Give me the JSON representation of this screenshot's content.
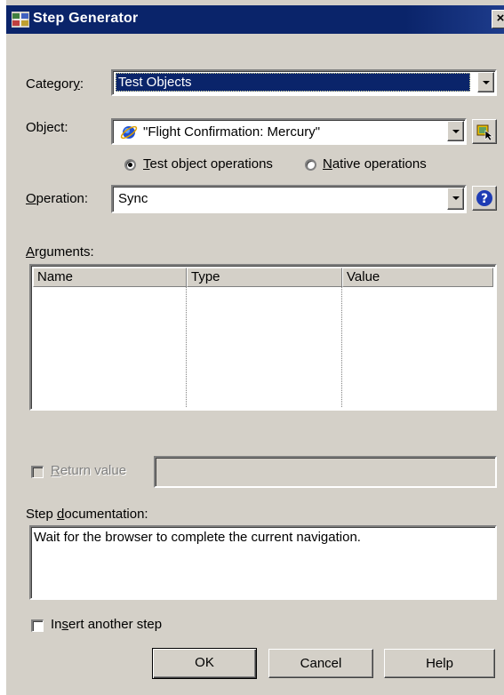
{
  "window": {
    "title": "Step Generator",
    "close_label": "×"
  },
  "category": {
    "label_pre": "Categor",
    "label_accel": "y",
    "label_post": ":",
    "value": "Test Objects"
  },
  "object": {
    "label": "Object:",
    "value": "\"Flight Confirmation: Mercury\""
  },
  "mode": {
    "test_accel": "T",
    "test_rest": "est object operations",
    "native_accel": "N",
    "native_rest": "ative operations",
    "selected": "test"
  },
  "operation": {
    "label_accel": "O",
    "label_rest": "peration:",
    "value": "Sync",
    "help_label": "?"
  },
  "arguments": {
    "label_accel": "A",
    "label_rest": "rguments:",
    "columns": [
      "Name",
      "Type",
      "Value"
    ],
    "rows": []
  },
  "return_value": {
    "label_accel": "R",
    "label_rest": "eturn value",
    "enabled": false,
    "value": ""
  },
  "documentation": {
    "label_pre": "Step ",
    "label_accel": "d",
    "label_rest": "ocumentation:",
    "text": "Wait for the browser to complete the current navigation."
  },
  "insert_another": {
    "label_pre": "In",
    "label_accel": "s",
    "label_rest": "ert another step",
    "checked": false
  },
  "buttons": {
    "ok": "OK",
    "cancel": "Cancel",
    "help": "Help"
  },
  "colors": {
    "titlebar": "#0a246a",
    "face": "#d4d0c8",
    "selection": "#0a246a"
  },
  "icons": {
    "title": "step-generator-icon",
    "object": "browser-globe-icon",
    "select_object": "object-repository-pointer-icon",
    "help": "help-question-icon"
  }
}
